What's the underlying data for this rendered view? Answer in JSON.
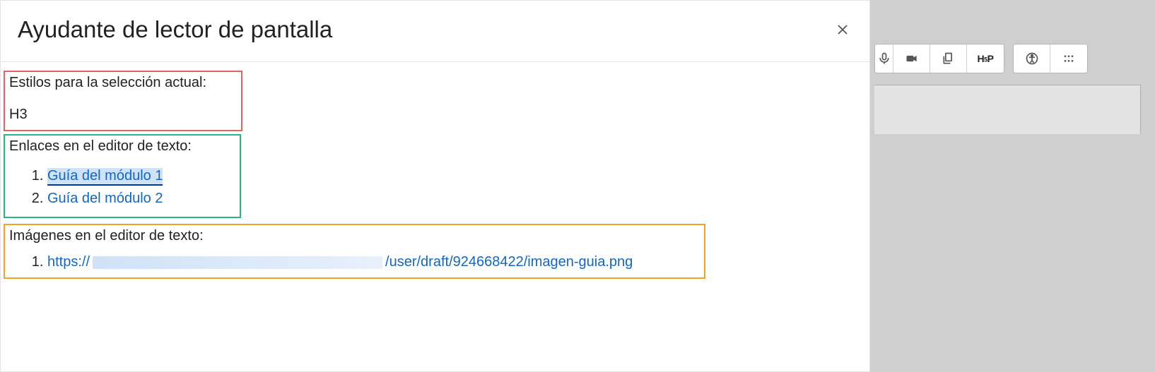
{
  "modal": {
    "title": "Ayudante de lector de pantalla"
  },
  "styles_section": {
    "label": "Estilos para la selección actual:",
    "value": "H3"
  },
  "links_section": {
    "label": "Enlaces en el editor de texto:",
    "items": [
      {
        "text": "Guía del módulo 1",
        "highlighted": true
      },
      {
        "text": "Guía del módulo 2",
        "highlighted": false
      }
    ]
  },
  "images_section": {
    "label": "Imágenes en el editor de texto:",
    "items": [
      {
        "prefix": "https://",
        "suffix": "/user/draft/924668422/imagen-guia.png"
      }
    ]
  },
  "toolbar": {
    "h5p_label": "H-P"
  }
}
